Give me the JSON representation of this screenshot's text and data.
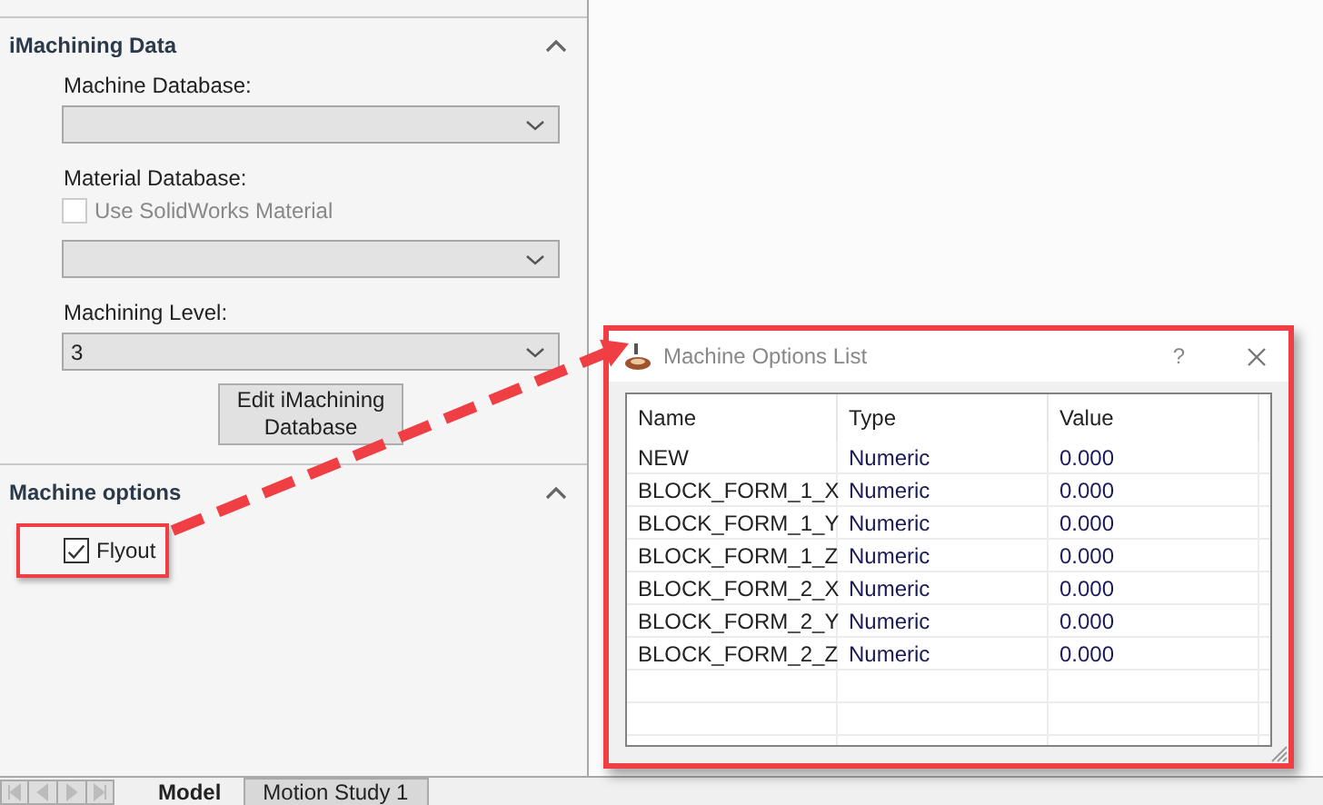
{
  "panel": {
    "sections": [
      {
        "title": "iMachining Data",
        "expanded": true,
        "items": [
          {
            "kind": "label",
            "text": "Machine Database:"
          },
          {
            "kind": "dropdown"
          },
          {
            "kind": "label",
            "text": "Material Database:"
          },
          {
            "kind": "checkbox",
            "label": "Use SolidWorks Material",
            "checked": false,
            "disabled": true,
            "highlighted": false
          },
          {
            "kind": "dropdown"
          },
          {
            "kind": "label",
            "text": "Machining Level:"
          },
          {
            "kind": "dropdown",
            "value": "3"
          },
          {
            "kind": "button",
            "label": "Edit iMachining Database"
          }
        ]
      },
      {
        "title": "Machine options",
        "expanded": true,
        "items": [
          {
            "kind": "checkbox",
            "label": "Flyout",
            "checked": true,
            "disabled": false,
            "highlighted": true
          }
        ]
      }
    ]
  },
  "dialog": {
    "title": "Machine Options List",
    "help": "?",
    "highlighted": true,
    "table": {
      "columns": [
        "Name",
        "Type",
        "Value"
      ],
      "rows": [
        [
          "NEW",
          "Numeric",
          "0.000"
        ],
        [
          "BLOCK_FORM_1_X",
          "Numeric",
          "0.000"
        ],
        [
          "BLOCK_FORM_1_Y",
          "Numeric",
          "0.000"
        ],
        [
          "BLOCK_FORM_1_Z",
          "Numeric",
          "0.000"
        ],
        [
          "BLOCK_FORM_2_X",
          "Numeric",
          "0.000"
        ],
        [
          "BLOCK_FORM_2_Y",
          "Numeric",
          "0.000"
        ],
        [
          "BLOCK_FORM_2_Z",
          "Numeric",
          "0.000"
        ]
      ]
    }
  },
  "bottom_tabs": [
    {
      "label": "Model",
      "selected": true
    },
    {
      "label": "Motion Study 1",
      "selected": false
    }
  ]
}
